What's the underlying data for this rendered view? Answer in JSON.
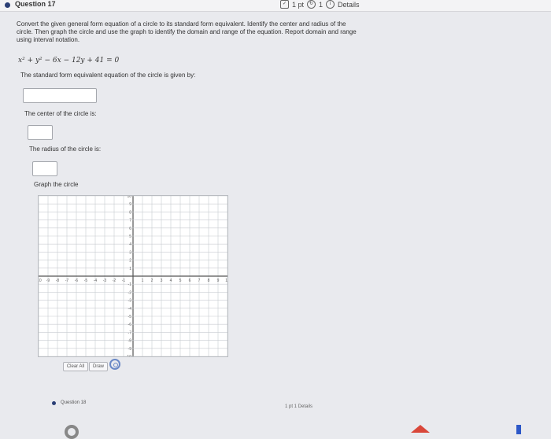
{
  "header": {
    "title": "Question 17",
    "points": "1 pt",
    "retries": "1",
    "details": "Details"
  },
  "instructions": "Convert the given general form equation of a circle to its standard form equivalent. Identify the center and radius of the circle. Then graph the circle and use the graph to identify the domain and range of the equation. Report domain and range using interval notation.",
  "equation": "x² + y² − 6x − 12y + 41 = 0",
  "prompts": {
    "standard_form": "The standard form equivalent equation of the circle is given by:",
    "center": "The center of the circle is:",
    "radius": "The radius of the circle is:",
    "graph": "Graph the circle"
  },
  "answers": {
    "standard_form": "",
    "center": "",
    "radius": ""
  },
  "graph": {
    "x_ticks": [
      "-10",
      "-9",
      "-8",
      "-7",
      "-6",
      "-5",
      "-4",
      "-3",
      "-2",
      "-1",
      "1",
      "2",
      "3",
      "4",
      "5",
      "6",
      "7",
      "8",
      "9",
      "10"
    ],
    "y_ticks": [
      "10",
      "9",
      "8",
      "7",
      "6",
      "5",
      "4",
      "3",
      "2",
      "1",
      "-1",
      "-2",
      "-3",
      "-4",
      "-5",
      "-6",
      "-7",
      "-8",
      "-9",
      "-10"
    ],
    "x_range": [
      -10,
      10
    ],
    "y_range": [
      -10,
      10
    ]
  },
  "toolbar": {
    "clear_all": "Clear All",
    "draw": "Draw"
  },
  "next_question": "Question 18",
  "footer_meta": "1 pt  1  Details"
}
